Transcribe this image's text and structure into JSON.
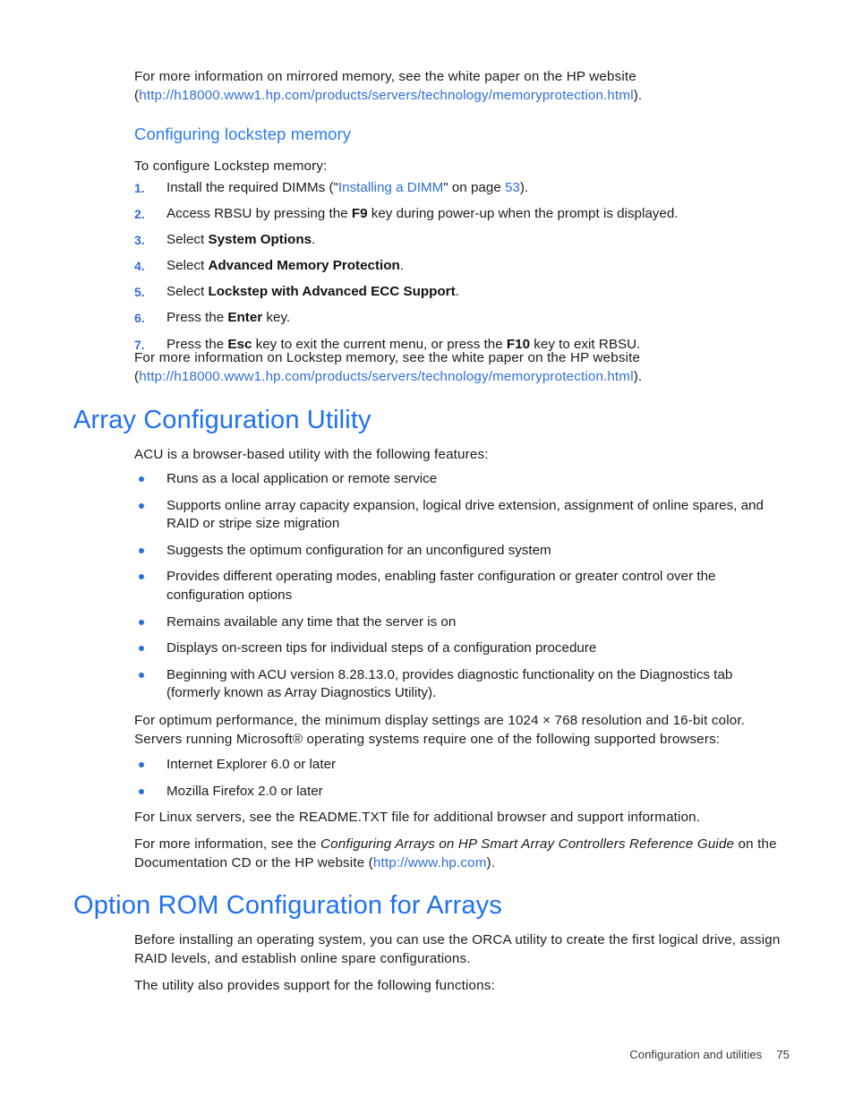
{
  "document": {
    "intro_mirrored": {
      "line1": "For more information on mirrored memory, see the white paper on the HP website",
      "paren_open": "(",
      "link": "http://h18000.www1.hp.com/products/servers/technology/memoryprotection.html",
      "paren_close": ")."
    },
    "lockstep_heading": "Configuring lockstep memory",
    "lockstep_lead": "To configure Lockstep memory:",
    "lockstep_steps": [
      {
        "num": "1.",
        "pre": "Install the required DIMMs (\"",
        "link1": "Installing a DIMM",
        "mid": "\" on page ",
        "link2": "53",
        "post": ")."
      },
      {
        "num": "2.",
        "pre": "Access RBSU by pressing the ",
        "bold": "F9",
        "post": " key during power-up when the prompt is displayed."
      },
      {
        "num": "3.",
        "pre": "Select ",
        "bold": "System Options",
        "post": "."
      },
      {
        "num": "4.",
        "pre": "Select ",
        "bold": "Advanced Memory Protection",
        "post": "."
      },
      {
        "num": "5.",
        "pre": "Select ",
        "bold": "Lockstep with Advanced ECC Support",
        "post": "."
      },
      {
        "num": "6.",
        "pre": "Press the ",
        "bold": "Enter",
        "post": " key."
      },
      {
        "num": "7.",
        "pre": "Press the ",
        "bold": "Esc",
        "mid": " key to exit the current menu, or press the ",
        "bold2": "F10",
        "post": " key to exit RBSU."
      }
    ],
    "lockstep_outro": {
      "line1": "For more information on Lockstep memory, see the white paper on the HP website",
      "paren_open": "(",
      "link": "http://h18000.www1.hp.com/products/servers/technology/memoryprotection.html",
      "paren_close": ")."
    },
    "acu": {
      "title": "Array Configuration Utility",
      "lead": "ACU is a browser-based utility with the following features:",
      "features": [
        "Runs as a local application or remote service",
        "Supports online array capacity expansion, logical drive extension, assignment of online spares, and RAID or stripe size migration",
        "Suggests the optimum configuration for an unconfigured system",
        "Provides different operating modes, enabling faster configuration or greater control over the configuration options",
        "Remains available any time that the server is on",
        "Displays on-screen tips for individual steps of a configuration procedure",
        "Beginning with ACU version 8.28.13.0, provides diagnostic functionality on the Diagnostics tab (formerly known as Array Diagnostics Utility)."
      ],
      "display_para": "For optimum performance, the minimum display settings are 1024 × 768 resolution and 16-bit color. Servers running Microsoft® operating systems require one of the following supported browsers:",
      "browsers": [
        "Internet Explorer 6.0 or later",
        "Mozilla Firefox 2.0 or later"
      ],
      "linux_para": "For Linux servers, see the README.TXT file for additional browser and support information.",
      "ref_para": {
        "pre": "For more information, see the ",
        "italic": "Configuring Arrays on HP Smart Array Controllers Reference Guide",
        "mid": " on the Documentation CD or the HP website (",
        "link": "http://www.hp.com",
        "post": ")."
      }
    },
    "orca": {
      "title": "Option ROM Configuration for Arrays",
      "para1": "Before installing an operating system, you can use the ORCA utility to create the first logical drive, assign RAID levels, and establish online spare configurations.",
      "para2": "The utility also provides support for the following functions:"
    },
    "footer": {
      "chapter": "Configuration and utilities",
      "page": "75"
    },
    "colors": {
      "heading_blue": "#1f71f2",
      "subheading_blue": "#2b7bf0",
      "link_blue": "#2f6fd8",
      "body_text": "#1c1c1c",
      "footer_text": "#3a3a3a"
    }
  }
}
